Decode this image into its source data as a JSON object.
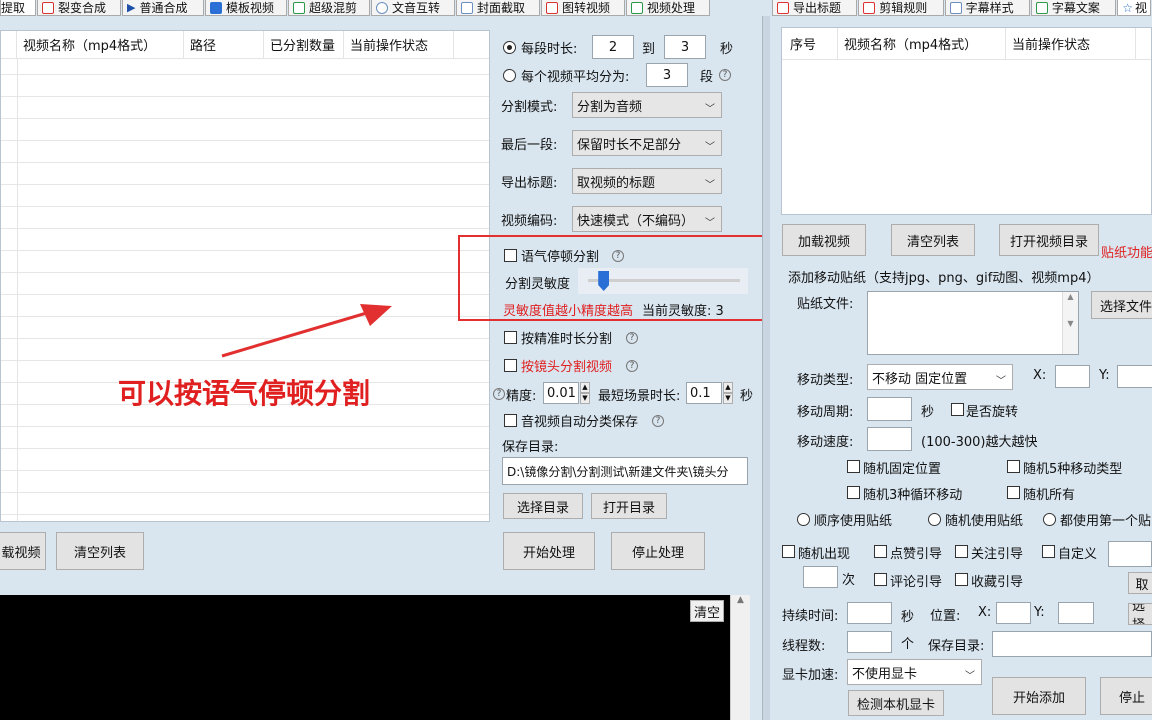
{
  "colors": {
    "accent": "#e02020",
    "console_bg": "#000000",
    "panel_bg": "#d9e6f0",
    "slider_thumb": "#2a6fd6"
  },
  "left_tabs": [
    {
      "label": "提取",
      "icon": "extract-icon"
    },
    {
      "label": "裂变合成",
      "icon": "fission-icon"
    },
    {
      "label": "普通合成",
      "icon": "play-icon"
    },
    {
      "label": "模板视频",
      "icon": "template-icon"
    },
    {
      "label": "超级混剪",
      "icon": "wave-icon"
    },
    {
      "label": "文音互转",
      "icon": "mic-icon"
    },
    {
      "label": "封面截取",
      "icon": "image-icon"
    },
    {
      "label": "图转视频",
      "icon": "picture-icon"
    },
    {
      "label": "视频处理",
      "icon": "grid-icon"
    }
  ],
  "right_tabs": [
    {
      "label": "导出标题",
      "icon": "export-icon"
    },
    {
      "label": "剪辑规则",
      "icon": "clip-icon"
    },
    {
      "label": "字幕样式",
      "icon": "doc-icon"
    },
    {
      "label": "字幕文案",
      "icon": "edit-icon"
    },
    {
      "label": "视",
      "icon": "star-icon"
    }
  ],
  "left_table": {
    "columns": [
      "视频名称（mp4格式）",
      "路径",
      "已分割数量",
      "当前操作状态"
    ]
  },
  "left_buttons": {
    "load": "载视频",
    "clear": "清空列表"
  },
  "annotation_text": "可以按语气停顿分割",
  "settings": {
    "per_segment": {
      "label": "每段时长:",
      "from": "2",
      "to_label": "到",
      "to": "3",
      "unit": "秒"
    },
    "avg_split": {
      "label": "每个视频平均分为:",
      "value": "3",
      "unit": "段"
    },
    "split_mode": {
      "label": "分割模式:",
      "value": "分割为音频"
    },
    "last_segment": {
      "label": "最后一段:",
      "value": "保留时长不足部分"
    },
    "export_title": {
      "label": "导出标题:",
      "value": "取视频的标题"
    },
    "video_encode": {
      "label": "视频编码:",
      "value": "快速模式（不编码）"
    },
    "pause_split": {
      "label": "语气停顿分割",
      "sensitivity_label": "分割灵敏度",
      "sensitivity_value": 0.1,
      "hint": "灵敏度值越小精度越高",
      "current_label": "当前灵敏度: 3"
    },
    "precise_split": "按精准时长分割",
    "shot_split": "按镜头分割视频",
    "precision_label": "精度:",
    "precision_value": "0.01",
    "min_scene_label": "最短场景时长:",
    "min_scene_value": "0.1",
    "min_scene_unit": "秒",
    "auto_classify": "音视频自动分类保存",
    "save_dir_label": "保存目录:",
    "save_dir_value": "D:\\镜像分割\\分割测试\\新建文件夹\\镜头分",
    "choose_dir": "选择目录",
    "open_dir": "打开目录",
    "start": "开始处理",
    "stop": "停止处理"
  },
  "console": {
    "clear": "清空"
  },
  "right_table": {
    "columns": [
      "序号",
      "视频名称（mp4格式）",
      "当前操作状态"
    ]
  },
  "right_panel": {
    "load_video": "加载视频",
    "clear_list": "清空列表",
    "open_video_dir": "打开视频目录",
    "sticker_feature": "贴纸功能",
    "add_sticker_title": "添加移动贴纸（支持jpg、png、gif动图、视频mp4）",
    "sticker_file_label": "贴纸文件:",
    "choose_file": "选择文件",
    "move_type_label": "移动类型:",
    "move_type_value": "不移动 固定位置",
    "x_label": "X:",
    "y_label": "Y:",
    "move_period_label": "移动周期:",
    "sec": "秒",
    "rotate": "是否旋转",
    "move_speed_label": "移动速度:",
    "speed_hint": "(100-300)越大越快",
    "random_fixed": "随机固定位置",
    "random_5types": "随机5种移动类型",
    "random_3loop": "随机3种循环移动",
    "random_all": "随机所有",
    "order_use": "顺序使用贴纸",
    "random_use": "随机使用贴纸",
    "use_first": "都使用第一个贴",
    "random_show": "随机出现",
    "like_guide": "点赞引导",
    "follow_guide": "关注引导",
    "custom": "自定义",
    "times": "次",
    "comment_guide": "评论引导",
    "fav_guide": "收藏引导",
    "cancel": "取",
    "duration_label": "持续时间:",
    "position_label": "位置:",
    "choose": "选择",
    "threads_label": "线程数:",
    "ge": "个",
    "save_dir_label": "保存目录:",
    "gpu_label": "显卡加速:",
    "gpu_value": "不使用显卡",
    "detect_gpu": "检测本机显卡",
    "start_add": "开始添加",
    "stop": "停止"
  }
}
